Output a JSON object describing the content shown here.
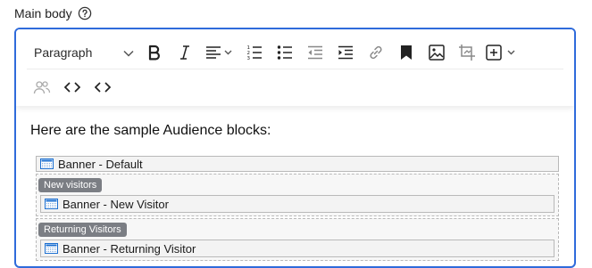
{
  "field": {
    "label": "Main body",
    "help_icon": "question-circle-icon"
  },
  "toolbar": {
    "format_value": "Paragraph",
    "row1": [
      {
        "name": "bold-button",
        "icon": "bold-icon"
      },
      {
        "name": "italic-button",
        "icon": "italic-icon"
      },
      {
        "name": "align-dropdown",
        "icon": "align-left-icon"
      },
      {
        "name": "numbered-list-button",
        "icon": "numbered-list-icon"
      },
      {
        "name": "bulleted-list-button",
        "icon": "bulleted-list-icon"
      },
      {
        "name": "outdent-button",
        "icon": "outdent-icon"
      },
      {
        "name": "indent-button",
        "icon": "indent-icon"
      },
      {
        "name": "link-button",
        "icon": "link-icon"
      },
      {
        "name": "bookmark-button",
        "icon": "bookmark-icon"
      },
      {
        "name": "image-button",
        "icon": "image-icon"
      },
      {
        "name": "crop-button",
        "icon": "crop-icon"
      },
      {
        "name": "insert-dropdown",
        "icon": "plus-box-icon"
      }
    ],
    "row2": [
      {
        "name": "audience-button",
        "icon": "people-icon"
      },
      {
        "name": "source-button",
        "icon": "code-icon"
      },
      {
        "name": "html-embed-button",
        "icon": "code-icon"
      }
    ]
  },
  "content": {
    "intro": "Here are the sample Audience blocks:",
    "default_block": "Banner - Default",
    "audiences": [
      {
        "badge": "New visitors",
        "block": "Banner - New Visitor"
      },
      {
        "badge": "Returning Visitors",
        "block": "Banner - Returning Visitor"
      }
    ]
  },
  "colors": {
    "accent": "#2f6bdb",
    "badge": "#7b7e84"
  }
}
